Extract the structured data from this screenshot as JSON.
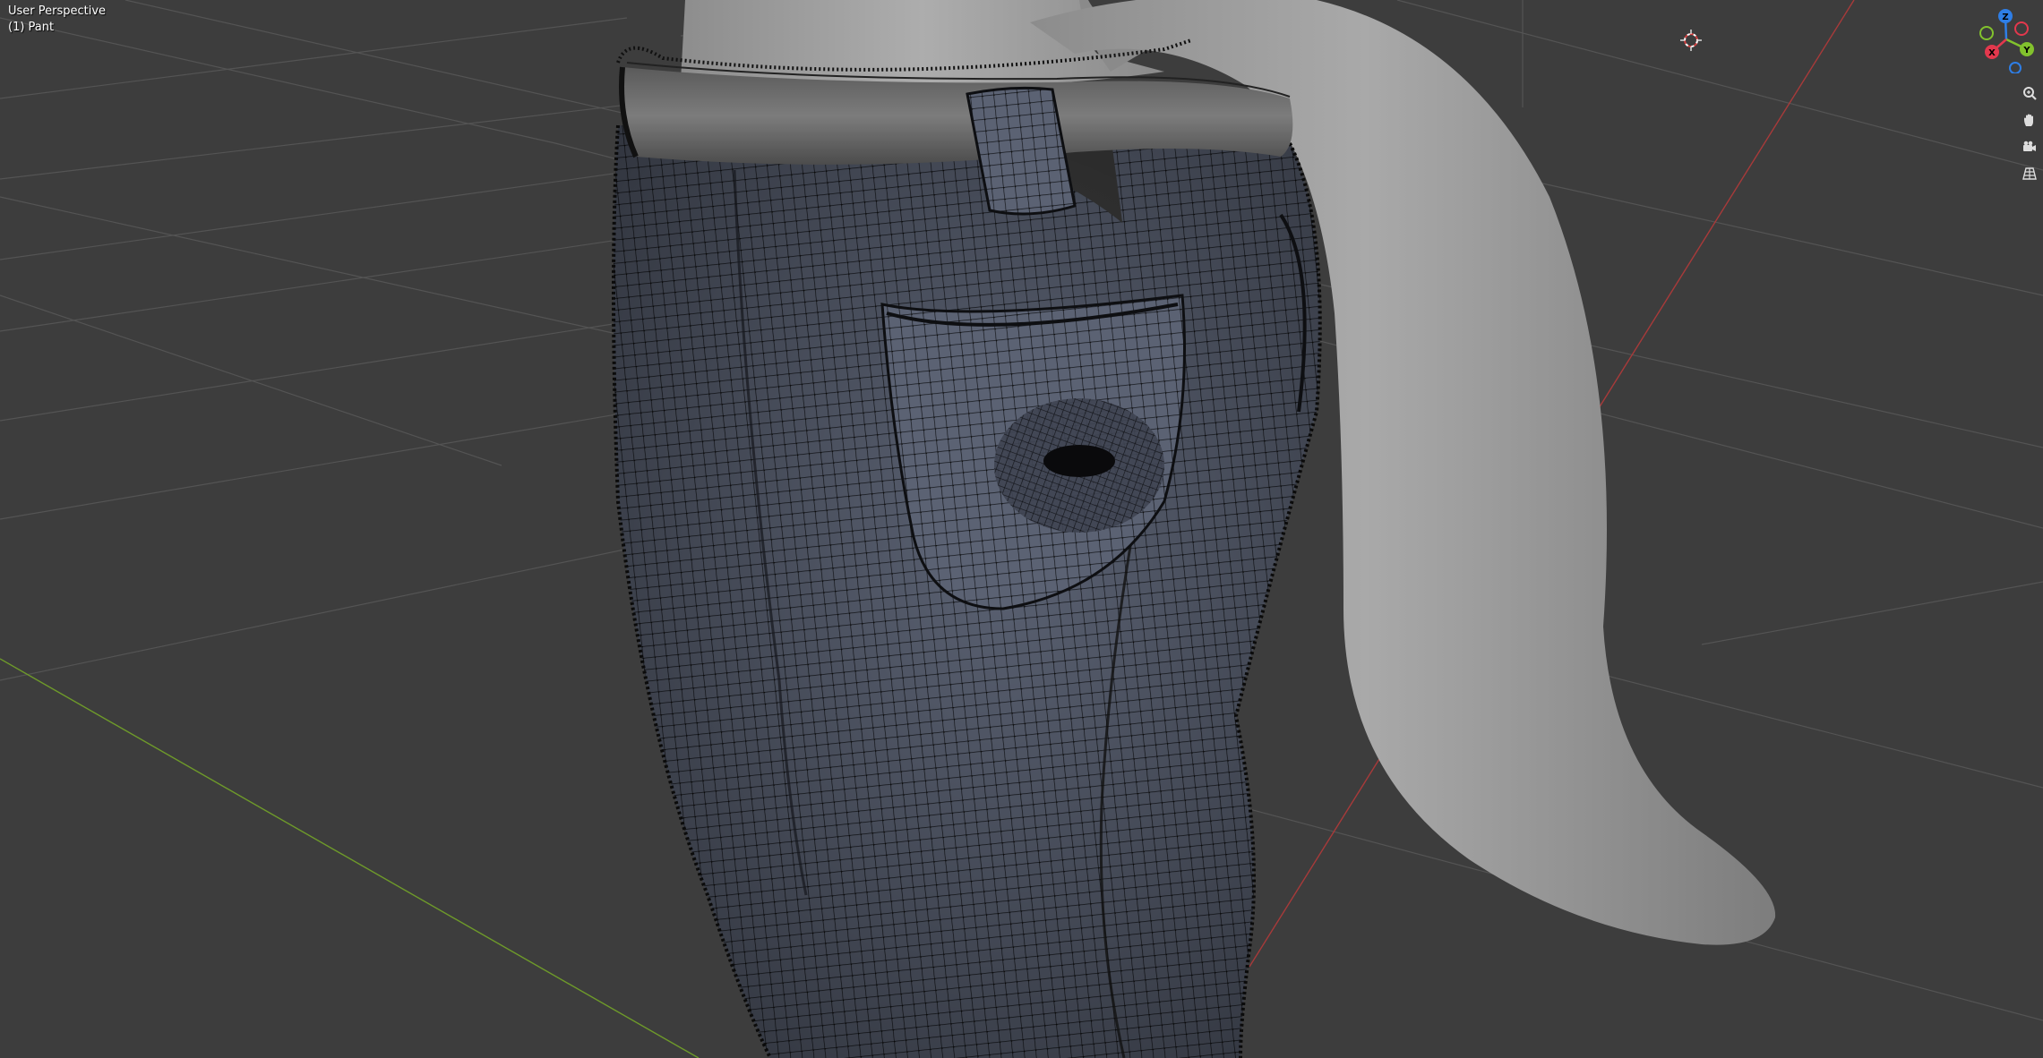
{
  "viewport": {
    "view_label": "User Perspective",
    "object_label": "(1) Pant",
    "background_color": "#3d3d3d",
    "grid_color": "#545454",
    "x_axis_color": "#a83a3a",
    "y_axis_color": "#6e9a2a"
  },
  "scene": {
    "active_object": "Pant",
    "pant_color": "#5b6273",
    "wire_color": "#111111",
    "belt_color": "#6f6f6f",
    "body_color": "#a3a3a3"
  },
  "gizmo": {
    "z_label": "Z",
    "y_label": "Y",
    "x_label": "X",
    "x_color": "#e3384d",
    "y_color": "#82c22d",
    "z_color": "#2e7ee6"
  },
  "nav_tools": [
    {
      "icon": "zoom-icon"
    },
    {
      "icon": "hand-pan-icon"
    },
    {
      "icon": "camera-icon"
    },
    {
      "icon": "grid-ortho-icon"
    }
  ]
}
